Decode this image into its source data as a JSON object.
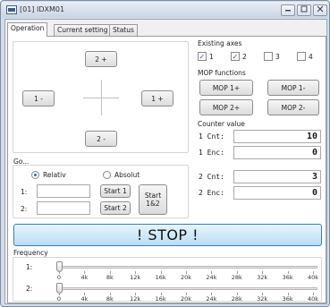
{
  "window": {
    "title": "[01] IDXM01"
  },
  "tabs": [
    "Operation",
    "Current setting",
    "Status"
  ],
  "jog": {
    "up": "2 +",
    "down": "2 -",
    "left": "1 -",
    "right": "1 +"
  },
  "go": {
    "title": "Go...",
    "relativ": "Relativ",
    "absolut": "Absolut",
    "row1_label": "1:",
    "row2_label": "2:",
    "row1_value": "",
    "row2_value": "",
    "start1": "Start 1",
    "start2": "Start 2",
    "start12": "Start 1&2"
  },
  "axes": {
    "title": "Existing axes",
    "items": [
      {
        "label": "1",
        "checked": true
      },
      {
        "label": "2",
        "checked": true
      },
      {
        "label": "3",
        "checked": false
      },
      {
        "label": "4",
        "checked": false
      }
    ]
  },
  "mop": {
    "title": "MOP functions",
    "buttons": [
      "MOP 1+",
      "MOP 1-",
      "MOP 2+",
      "MOP 2-"
    ]
  },
  "counter": {
    "title": "Counter value",
    "rows": [
      {
        "label": "1 Cnt:",
        "value": "10"
      },
      {
        "label": "1 Enc:",
        "value": "0"
      },
      {
        "label": "2 Cnt:",
        "value": "3"
      },
      {
        "label": "2 Enc:",
        "value": "0"
      }
    ]
  },
  "stop_label": "! STOP !",
  "frequency": {
    "title": "Frequency",
    "row1_label": "1:",
    "row2_label": "2:",
    "ticks": [
      "0",
      "4k",
      "8k",
      "12k",
      "16k",
      "20k",
      "24k",
      "28k",
      "32k",
      "36k",
      "40k"
    ],
    "value1": 0,
    "value2": 0
  },
  "colors": {
    "stop_fill": "#b9def6",
    "stop_border": "#3c7fb1",
    "check": "#2a5db0"
  }
}
